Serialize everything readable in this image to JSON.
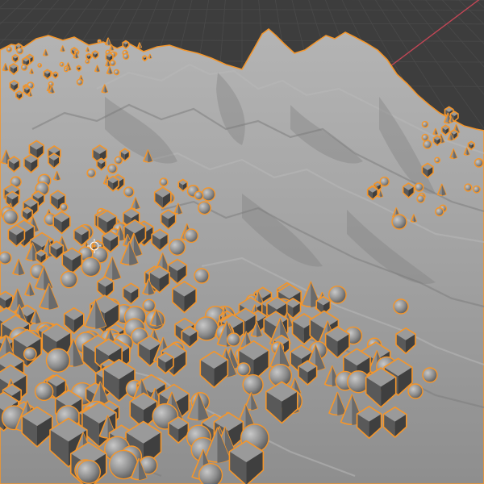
{
  "editor": "3d-viewport",
  "view": "perspective",
  "shading": "solid",
  "grid": true,
  "selection": {
    "state": "selected",
    "outline_color": "#f5962a"
  },
  "colors": {
    "background": "#3d3d3d",
    "grid_line": "#4a4a4a",
    "x_axis": "#c24655",
    "terrain": "#9c9c9c",
    "object": "#8a8a8a"
  },
  "scattered_objects": [
    "cube",
    "cone",
    "sphere"
  ],
  "markers": [
    "object-origin-icon"
  ]
}
